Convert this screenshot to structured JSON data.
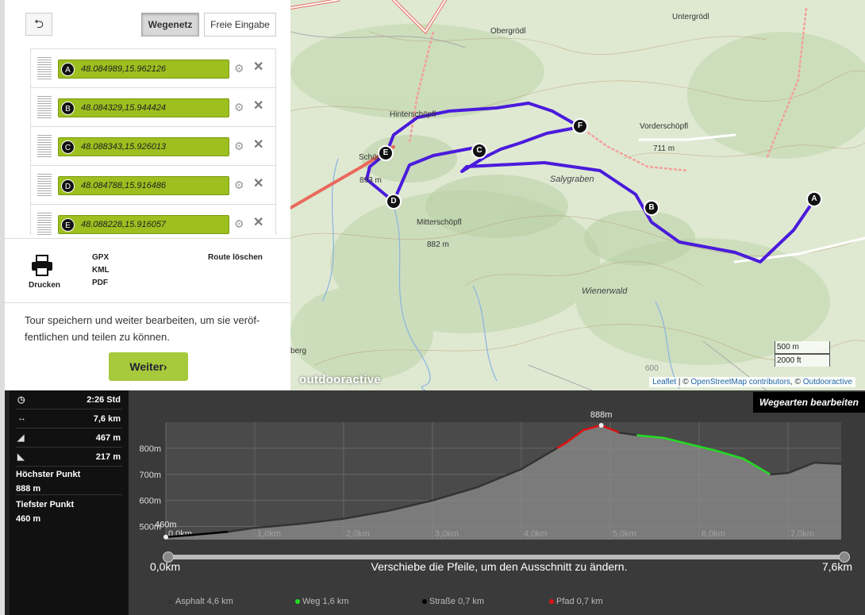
{
  "panel": {
    "back_label": "⮌",
    "mode_active": "Wegenetz",
    "mode_other": "Freie Eingabe",
    "waypoints": [
      {
        "letter": "A",
        "coord": "48.084989,15.962126"
      },
      {
        "letter": "B",
        "coord": "48.084329,15.944424"
      },
      {
        "letter": "C",
        "coord": "48.088343,15.926013"
      },
      {
        "letter": "D",
        "coord": "48.084788,15.916486"
      },
      {
        "letter": "E",
        "coord": "48.088228,15.916057"
      }
    ],
    "print_label": "Drucken",
    "exports": [
      "GPX",
      "KML",
      "PDF"
    ],
    "delete_route": "Route löschen",
    "save_text": "Tour speichern und weiter bearbeiten, um sie veröf-fentlichen und teilen zu können.",
    "continue_label": "Weiter›"
  },
  "map": {
    "places": {
      "untergrodl": "Untergrödl",
      "obergrodl": "Obergrödl",
      "hinterschopfl": "Hinterschöpfl",
      "vorderschopfl": "Vorderschöpfl",
      "vorder_elev": "711 m",
      "schop": "Schöp",
      "schop_elev": "893 m",
      "salygraben": "Salygraben",
      "mitterschopfl": "Mitterschöpfl",
      "mitter_elev": "882 m",
      "wienerwald": "Wienerwald",
      "berg": "berg",
      "six_hundred": "600"
    },
    "markers": [
      "A",
      "B",
      "C",
      "D",
      "E",
      "F"
    ],
    "route_color": "#4a1bdc",
    "scale_m": "500 m",
    "scale_ft": "2000 ft",
    "logo": "outdooractive",
    "attribution": {
      "leaflet": "Leaflet",
      "sep": " | © ",
      "osm": "OpenStreetMap contributors",
      "sep2": ", © ",
      "oa": "Outdooractive"
    }
  },
  "stats": {
    "duration": "2:26 Std",
    "distance": "7,6 km",
    "ascent": "467 m",
    "descent": "217 m",
    "highest_label": "Höchster Punkt",
    "highest_value": "888 m",
    "lowest_label": "Tiefster Punkt",
    "lowest_value": "460 m"
  },
  "elevation": {
    "edit_label": "Wegearten bearbeiten",
    "slider_start": "0,0km",
    "slider_end": "7,6km",
    "slider_hint": "Verschiebe die Pfeile, um den Ausschnitt zu ändern.",
    "legend": [
      {
        "label": "Asphalt 4,6 km",
        "color": "#333333"
      },
      {
        "label": "Weg 1,6 km",
        "color": "#22dd22"
      },
      {
        "label": "Straße 0,7 km",
        "color": "#000000"
      },
      {
        "label": "Pfad 0,7 km",
        "color": "#dd1111"
      }
    ]
  },
  "chart_data": {
    "type": "area",
    "xlabel": "",
    "ylabel": "",
    "x_ticks": [
      "0,0km",
      "1,0km",
      "2,0km",
      "3,0km",
      "4,0km",
      "5,0km",
      "6,0km",
      "7,0km"
    ],
    "y_ticks": [
      "500m",
      "600m",
      "700m",
      "800m"
    ],
    "xlim": [
      0,
      7.6
    ],
    "ylim": [
      460,
      888
    ],
    "max_label": "888m",
    "min_label": "460m",
    "x": [
      0,
      0.3,
      0.7,
      1.0,
      1.5,
      2.0,
      2.5,
      3.0,
      3.5,
      4.0,
      4.2,
      4.5,
      4.7,
      4.9,
      5.1,
      5.3,
      5.6,
      5.9,
      6.2,
      6.5,
      6.8,
      7.0,
      7.3,
      7.6
    ],
    "y": [
      460,
      468,
      480,
      495,
      510,
      530,
      560,
      600,
      650,
      720,
      760,
      820,
      870,
      888,
      860,
      850,
      840,
      815,
      790,
      760,
      700,
      705,
      745,
      740
    ],
    "segment_colors": [
      {
        "from": 0,
        "to": 0.7,
        "color": "#000000"
      },
      {
        "from": 0.7,
        "to": 4.4,
        "color": "#333333"
      },
      {
        "from": 4.4,
        "to": 5.1,
        "color": "#dd1111"
      },
      {
        "from": 5.1,
        "to": 5.3,
        "color": "#333333"
      },
      {
        "from": 5.3,
        "to": 6.8,
        "color": "#22dd22"
      },
      {
        "from": 6.8,
        "to": 7.6,
        "color": "#333333"
      }
    ]
  }
}
